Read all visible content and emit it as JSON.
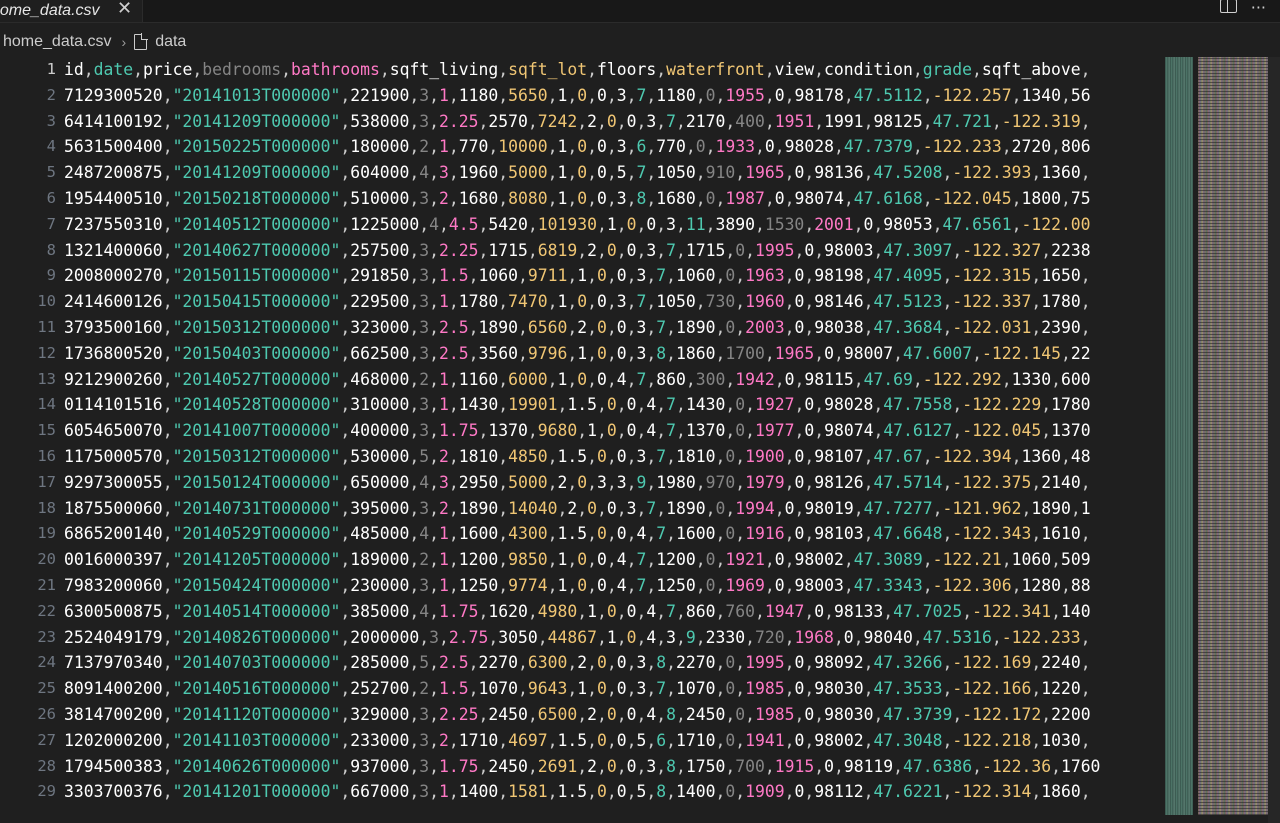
{
  "tab": {
    "label": "home_data.csv",
    "close_icon": "close-icon"
  },
  "actions": [
    {
      "name": "split-editor-icon"
    },
    {
      "name": "more-actions-icon",
      "glyph": "···"
    }
  ],
  "breadcrumb": {
    "file": "home_data.csv",
    "separator": "›",
    "item": "data"
  },
  "colors": {
    "col_white": "#ffffff",
    "col_cyan": "#4ec9b0",
    "col_gray": "#858585",
    "col_pink": "#ff79c6",
    "col_yellow": "#f0c674"
  },
  "editor": {
    "lines": [
      {
        "n": "1",
        "text": "id,date,price,bedrooms,bathrooms,sqft_living,sqft_lot,floors,waterfront,view,condition,grade,sqft_above,"
      },
      {
        "n": "2",
        "text": "7129300520,\"20141013T000000\",221900,3,1,1180,5650,1,0,0,3,7,1180,0,1955,0,98178,47.5112,-122.257,1340,56"
      },
      {
        "n": "3",
        "text": "6414100192,\"20141209T000000\",538000,3,2.25,2570,7242,2,0,0,3,7,2170,400,1951,1991,98125,47.721,-122.319,"
      },
      {
        "n": "4",
        "text": "5631500400,\"20150225T000000\",180000,2,1,770,10000,1,0,0,3,6,770,0,1933,0,98028,47.7379,-122.233,2720,806"
      },
      {
        "n": "5",
        "text": "2487200875,\"20141209T000000\",604000,4,3,1960,5000,1,0,0,5,7,1050,910,1965,0,98136,47.5208,-122.393,1360,"
      },
      {
        "n": "6",
        "text": "1954400510,\"20150218T000000\",510000,3,2,1680,8080,1,0,0,3,8,1680,0,1987,0,98074,47.6168,-122.045,1800,75"
      },
      {
        "n": "7",
        "text": "7237550310,\"20140512T000000\",1225000,4,4.5,5420,101930,1,0,0,3,11,3890,1530,2001,0,98053,47.6561,-122.00"
      },
      {
        "n": "8",
        "text": "1321400060,\"20140627T000000\",257500,3,2.25,1715,6819,2,0,0,3,7,1715,0,1995,0,98003,47.3097,-122.327,2238"
      },
      {
        "n": "9",
        "text": "2008000270,\"20150115T000000\",291850,3,1.5,1060,9711,1,0,0,3,7,1060,0,1963,0,98198,47.4095,-122.315,1650,"
      },
      {
        "n": "10",
        "text": "2414600126,\"20150415T000000\",229500,3,1,1780,7470,1,0,0,3,7,1050,730,1960,0,98146,47.5123,-122.337,1780,"
      },
      {
        "n": "11",
        "text": "3793500160,\"20150312T000000\",323000,3,2.5,1890,6560,2,0,0,3,7,1890,0,2003,0,98038,47.3684,-122.031,2390,"
      },
      {
        "n": "12",
        "text": "1736800520,\"20150403T000000\",662500,3,2.5,3560,9796,1,0,0,3,8,1860,1700,1965,0,98007,47.6007,-122.145,22"
      },
      {
        "n": "13",
        "text": "9212900260,\"20140527T000000\",468000,2,1,1160,6000,1,0,0,4,7,860,300,1942,0,98115,47.69,-122.292,1330,600"
      },
      {
        "n": "14",
        "text": "0114101516,\"20140528T000000\",310000,3,1,1430,19901,1.5,0,0,4,7,1430,0,1927,0,98028,47.7558,-122.229,1780"
      },
      {
        "n": "15",
        "text": "6054650070,\"20141007T000000\",400000,3,1.75,1370,9680,1,0,0,4,7,1370,0,1977,0,98074,47.6127,-122.045,1370"
      },
      {
        "n": "16",
        "text": "1175000570,\"20150312T000000\",530000,5,2,1810,4850,1.5,0,0,3,7,1810,0,1900,0,98107,47.67,-122.394,1360,48"
      },
      {
        "n": "17",
        "text": "9297300055,\"20150124T000000\",650000,4,3,2950,5000,2,0,3,3,9,1980,970,1979,0,98126,47.5714,-122.375,2140,"
      },
      {
        "n": "18",
        "text": "1875500060,\"20140731T000000\",395000,3,2,1890,14040,2,0,0,3,7,1890,0,1994,0,98019,47.7277,-121.962,1890,1"
      },
      {
        "n": "19",
        "text": "6865200140,\"20140529T000000\",485000,4,1,1600,4300,1.5,0,0,4,7,1600,0,1916,0,98103,47.6648,-122.343,1610,"
      },
      {
        "n": "20",
        "text": "0016000397,\"20141205T000000\",189000,2,1,1200,9850,1,0,0,4,7,1200,0,1921,0,98002,47.3089,-122.21,1060,509"
      },
      {
        "n": "21",
        "text": "7983200060,\"20150424T000000\",230000,3,1,1250,9774,1,0,0,4,7,1250,0,1969,0,98003,47.3343,-122.306,1280,88"
      },
      {
        "n": "22",
        "text": "6300500875,\"20140514T000000\",385000,4,1.75,1620,4980,1,0,0,4,7,860,760,1947,0,98133,47.7025,-122.341,140"
      },
      {
        "n": "23",
        "text": "2524049179,\"20140826T000000\",2000000,3,2.75,3050,44867,1,0,4,3,9,2330,720,1968,0,98040,47.5316,-122.233,"
      },
      {
        "n": "24",
        "text": "7137970340,\"20140703T000000\",285000,5,2.5,2270,6300,2,0,0,3,8,2270,0,1995,0,98092,47.3266,-122.169,2240,"
      },
      {
        "n": "25",
        "text": "8091400200,\"20140516T000000\",252700,2,1.5,1070,9643,1,0,0,3,7,1070,0,1985,0,98030,47.3533,-122.166,1220,"
      },
      {
        "n": "26",
        "text": "3814700200,\"20141120T000000\",329000,3,2.25,2450,6500,2,0,0,4,8,2450,0,1985,0,98030,47.3739,-122.172,2200"
      },
      {
        "n": "27",
        "text": "1202000200,\"20141103T000000\",233000,3,2,1710,4697,1.5,0,0,5,6,1710,0,1941,0,98002,47.3048,-122.218,1030,"
      },
      {
        "n": "28",
        "text": "1794500383,\"20140626T000000\",937000,3,1.75,2450,2691,2,0,0,3,8,1750,700,1915,0,98119,47.6386,-122.36,1760"
      },
      {
        "n": "29",
        "text": "3303700376,\"20141201T000000\",667000,3,1,1400,1581,1.5,0,0,5,8,1400,0,1909,0,98112,47.6221,-122.314,1860,"
      }
    ]
  }
}
